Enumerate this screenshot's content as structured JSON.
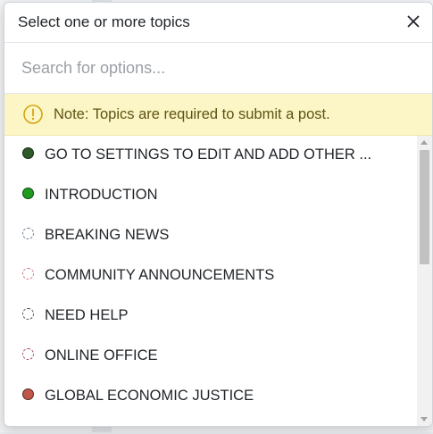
{
  "modal": {
    "title": "Select one or more topics"
  },
  "search": {
    "placeholder": "Search for options..."
  },
  "note": {
    "text": "Note: Topics are required to submit a post.",
    "accent_color": "#d6a50f",
    "background_color": "#fcf6c6"
  },
  "topics": [
    {
      "label": "GO TO SETTINGS TO EDIT AND ADD OTHER ...",
      "color": "#2f5a2a",
      "style": "filled"
    },
    {
      "label": "INTRODUCTION",
      "color": "#1f9b1f",
      "style": "filled"
    },
    {
      "label": "BREAKING NEWS",
      "color": "#6f7f95",
      "style": "dashed"
    },
    {
      "label": "COMMUNITY ANNOUNCEMENTS",
      "color": "#d07a87",
      "style": "dashed"
    },
    {
      "label": "NEED HELP",
      "color": "#555555",
      "style": "dashed"
    },
    {
      "label": "ONLINE OFFICE",
      "color": "#b04c6a",
      "style": "dashed"
    },
    {
      "label": "GLOBAL ECONOMIC JUSTICE",
      "color": "#c0584a",
      "style": "filled"
    }
  ],
  "icons": {
    "close": "close-icon",
    "note": "info-circle-icon"
  }
}
